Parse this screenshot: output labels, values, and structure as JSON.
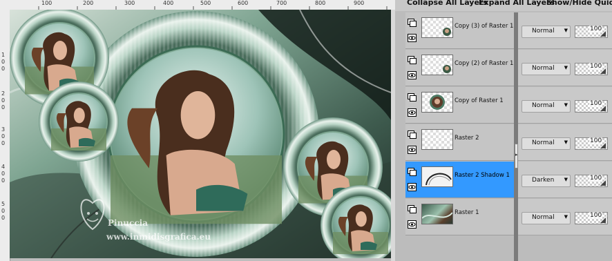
{
  "toolbar": {
    "collapse_all": "Collapse All Layers",
    "expand_all": "Expand All Layers",
    "show_hide": "Show/Hide Quick S"
  },
  "ruler": {
    "top_labels": [
      "100",
      "200",
      "300",
      "400",
      "500",
      "600",
      "700",
      "800",
      "900"
    ],
    "left_labels": [
      "1",
      "0",
      "0",
      "2",
      "0",
      "0",
      "3",
      "0",
      "0",
      "4",
      "0",
      "0",
      "5",
      "0",
      "0"
    ]
  },
  "watermark": {
    "name": "Pinuccia",
    "site": "www.inmidisgrafica.eu"
  },
  "layers": [
    {
      "name": "Copy (3) of Raster 1",
      "blend": "Normal",
      "opacity": "100",
      "selected": false,
      "thumb": "small-portrait"
    },
    {
      "name": "Copy (2) of Raster 1",
      "blend": "Normal",
      "opacity": "100",
      "selected": false,
      "thumb": "small-portrait"
    },
    {
      "name": "Copy of Raster 1",
      "blend": "Normal",
      "opacity": "100",
      "selected": false,
      "thumb": "circle-portrait"
    },
    {
      "name": "Raster 2",
      "blend": "Normal",
      "opacity": "100",
      "selected": false,
      "thumb": "empty"
    },
    {
      "name": "Raster 2 Shadow 1",
      "blend": "Darken",
      "opacity": "100",
      "selected": true,
      "thumb": "shadow-arc"
    },
    {
      "name": "Raster 1",
      "blend": "Normal",
      "opacity": "100",
      "selected": false,
      "thumb": "background"
    }
  ],
  "colors": {
    "selected_row": "#3399ff",
    "canvas_teal": "#6f9a86",
    "frame_green": "#8fbfa8"
  },
  "icons": {
    "mask": "layer-mask-icon",
    "visibility": "eye-icon",
    "blend_dropdown": "chevron-down-icon",
    "divider": "panel-splitter-icon"
  }
}
